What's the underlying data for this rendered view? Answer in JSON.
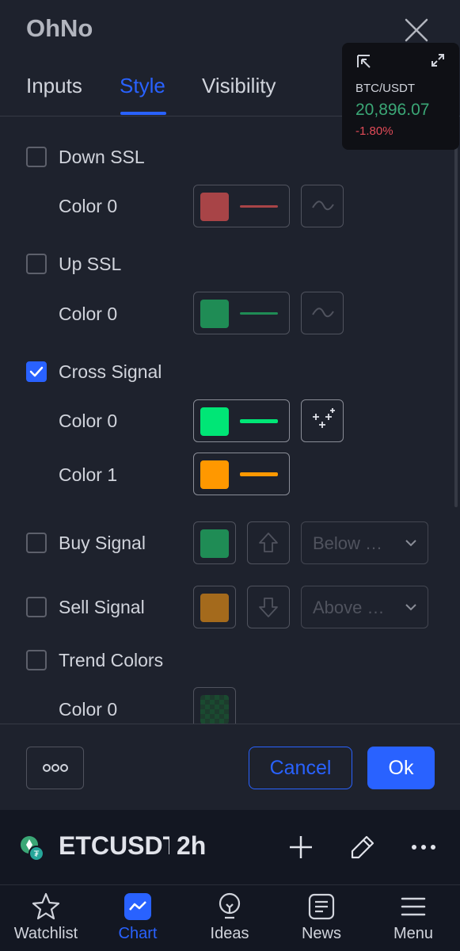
{
  "dialog": {
    "title": "OhNo",
    "tabs": [
      {
        "label": "Inputs",
        "active": false
      },
      {
        "label": "Style",
        "active": true
      },
      {
        "label": "Visibility",
        "active": false
      }
    ]
  },
  "ticker": {
    "symbol": "BTC/USDT",
    "price": "20,896.07",
    "change": "-1.80%"
  },
  "style": {
    "down_ssl": {
      "label": "Down SSL",
      "checked": false,
      "color0_label": "Color 0",
      "color0": "#a84447"
    },
    "up_ssl": {
      "label": "Up SSL",
      "checked": false,
      "color0_label": "Color 0",
      "color0": "#1f8c55"
    },
    "cross_signal": {
      "label": "Cross Signal",
      "checked": true,
      "color0_label": "Color 0",
      "color0": "#00e676",
      "color1_label": "Color 1",
      "color1": "#ff9800"
    },
    "buy_signal": {
      "label": "Buy Signal",
      "checked": false,
      "color": "#1f8c55",
      "location": "Below …"
    },
    "sell_signal": {
      "label": "Sell Signal",
      "checked": false,
      "color": "#a46a1c",
      "location": "Above …"
    },
    "trend_colors": {
      "label": "Trend Colors",
      "checked": false,
      "color0_label": "Color 0"
    }
  },
  "footer": {
    "more_label": "○○○",
    "cancel_label": "Cancel",
    "ok_label": "Ok"
  },
  "symbol_bar": {
    "symbol": "ETCUSDT",
    "interval": "2h"
  },
  "nav": [
    {
      "label": "Watchlist",
      "icon": "star-icon"
    },
    {
      "label": "Chart",
      "icon": "chart-icon",
      "active": true
    },
    {
      "label": "Ideas",
      "icon": "lightbulb-icon"
    },
    {
      "label": "News",
      "icon": "news-icon"
    },
    {
      "label": "Menu",
      "icon": "menu-icon"
    }
  ],
  "colors": {
    "accent": "#2962ff",
    "background": "#1e222d",
    "price_up": "#3ba776",
    "price_down": "#e24b58"
  }
}
